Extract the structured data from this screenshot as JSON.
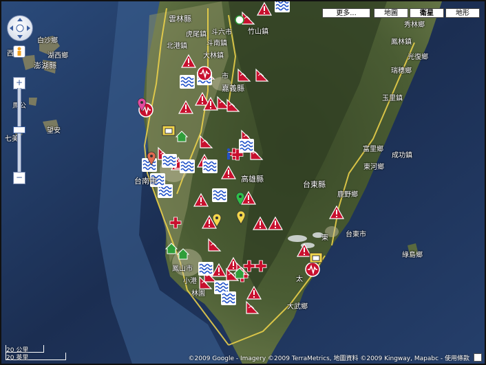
{
  "controls": {
    "more": "更多...",
    "map": "地圖",
    "satellite": "衛星",
    "terrain": "地形",
    "zoom_in": "+",
    "zoom_out": "−"
  },
  "labels": {
    "yunlin": "雲林縣",
    "huwei": "虎尾鎮",
    "beigang": "北港鎮",
    "douliu": "斗六市",
    "dounan": "斗南鎮",
    "dalin": "大林鎮",
    "shi": "市",
    "zhushan": "竹山鎮",
    "penghu": "澎湖縣",
    "baisha": "白沙鄉",
    "xiyu": "西嶼",
    "huxi": "湖西鄉",
    "magong": "馬公",
    "wangan": "望安",
    "qimei": "七美",
    "chiayi": "嘉義縣",
    "tainan": "台南市",
    "kaohsiung": "高雄縣",
    "fengshan": "鳳山市",
    "xiaogang": "小港",
    "linyuan": "林園",
    "taitung": "台東縣",
    "taitung_city": "台東市",
    "luye": "鹿野鄉",
    "donghe": "東河鄉",
    "chenggong": "成功鎮",
    "fuli": "富里鄉",
    "yuli": "玉里鎮",
    "ruisui": "瑞穗鄉",
    "guangfu": "光復鄉",
    "fenglin": "鳳林鎮",
    "xiulin": "秀林鄉",
    "lvdao": "綠島鄉",
    "dawu": "大武鄉",
    "tai": "太",
    "dong": "東"
  },
  "scale": {
    "km": "20 公里",
    "mi": "20 英里"
  },
  "copyright": "©2009 Google - Imagery ©2009 TerraMetrics, 地圖資料 ©2009 Kingway, Mapabc - 使用條款",
  "colors": {
    "warning": "#c8102e",
    "flood": "#1e50c8",
    "land": "#3e5a2e",
    "sea": "#1b2e52",
    "road": "#f2d64b"
  },
  "icons": [
    "warning-triangle-icon",
    "flood-wave-icon",
    "earthquake-icon",
    "medical-cross-icon",
    "info-icon",
    "home-icon",
    "camera-icon",
    "pin-icon"
  ]
}
